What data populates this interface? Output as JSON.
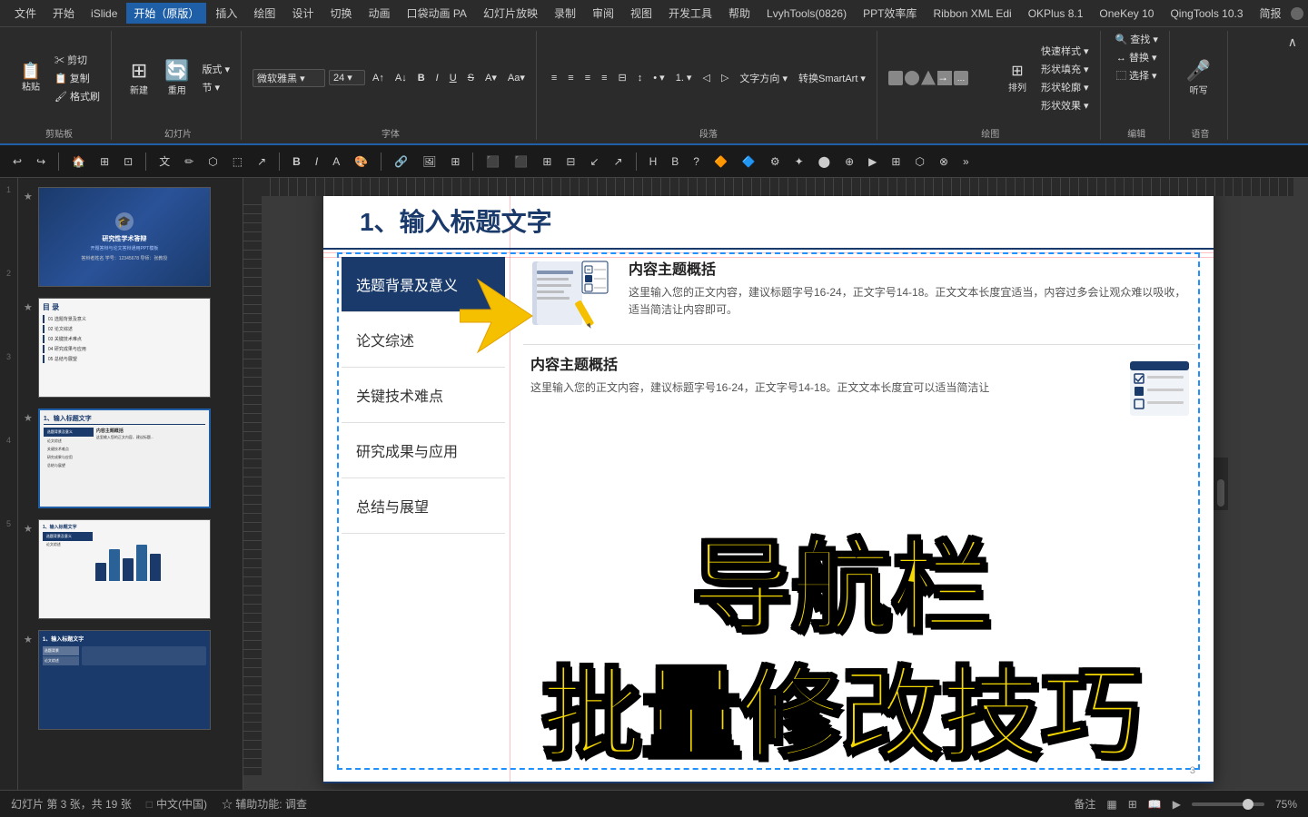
{
  "menubar": {
    "items": [
      "文件",
      "开始",
      "iSlide",
      "开始（原版）",
      "插入",
      "绘图",
      "设计",
      "切换",
      "动画",
      "口袋动画 PA",
      "幻灯片放映",
      "录制",
      "审阅",
      "视图",
      "开发工具",
      "帮助",
      "LvyhTools(0826)",
      "PPT效率库",
      "Ribbon XML Edi",
      "OKPlus 8.1",
      "OneKey 10",
      "QingTools 10.3",
      "简报"
    ],
    "active": "开始（原版）"
  },
  "ribbon": {
    "groups": [
      {
        "name": "剪贴板",
        "buttons": [
          "粘贴",
          "剪切",
          "复制",
          "格式刷"
        ]
      },
      {
        "name": "幻灯片",
        "buttons": [
          "新建幻灯片",
          "重用幻灯片",
          "版式",
          "节"
        ]
      },
      {
        "name": "字体",
        "buttons": [
          "B",
          "I",
          "U",
          "S",
          "字体",
          "字号",
          "颜色"
        ]
      },
      {
        "name": "段落",
        "buttons": [
          "左对齐",
          "居中",
          "右对齐",
          "两端对齐",
          "分散对齐",
          "项目符号",
          "编号"
        ]
      },
      {
        "name": "绘图",
        "buttons": [
          "形状",
          "排列",
          "快速样式",
          "形状填充",
          "形状轮廓",
          "形状效果"
        ]
      },
      {
        "name": "编辑",
        "buttons": [
          "查找",
          "替换",
          "选择"
        ]
      },
      {
        "name": "语音",
        "buttons": [
          "听写"
        ]
      }
    ]
  },
  "formatbar": {
    "buttons": [
      "✂",
      "📋",
      "B",
      "I",
      "U",
      "A",
      "⬜",
      "⭕",
      "△",
      "→",
      "T",
      "🔗"
    ]
  },
  "slides": [
    {
      "number": "1",
      "title": "研究性学术答辩",
      "subtitle": "开题答辩与论文答辩通用PPT模板",
      "author": "答辩者姓名 学号：12345678 导师：张教授"
    },
    {
      "number": "2",
      "title": "目录"
    },
    {
      "number": "3",
      "title": "1、输入标题文字",
      "active": true
    },
    {
      "number": "4",
      "title": "1、输入标题文字"
    },
    {
      "number": "5",
      "title": "1、输入标题文字"
    }
  ],
  "slide_active": {
    "title": "1、输入标题文字",
    "nav_items": [
      "选题背景及意义",
      "论文综述",
      "关键技术难点",
      "研究成果与应用",
      "总结与展望"
    ],
    "nav_active": "选题背景及意义",
    "content_heading_1": "内容主题概括",
    "content_body_1": "这里输入您的正文内容，建议标题字号16-24，正文字号14-18。正文文本长度宜适当，内容过多会让观众难以吸收，适当简洁让内容即可。",
    "content_heading_2": "内容主题概括",
    "content_body_2": "这里输入您的正文内容，建议标题字号16-24，正文字号14-18。正文文本长度宜可以适当简洁让",
    "overlay_line1": "导航栏",
    "overlay_line2": "批量修改技巧"
  },
  "statusbar": {
    "slide_info": "幻灯片 第 3 张，共 19 张",
    "language": "中文(中国)",
    "accessibility": "☆ 辅助功能: 调查",
    "notes": "备注",
    "view_normal": "▦",
    "view_slide_sorter": "⊞",
    "view_reading": "📖",
    "view_slideshow": "▶",
    "zoom": "75%"
  },
  "icons": {
    "paste": "📋",
    "cut": "✂",
    "copy": "📋",
    "format_painter": "🖌",
    "new_slide": "➕",
    "bold": "B",
    "italic": "I",
    "underline": "U",
    "search": "🔍",
    "microphone": "🎤",
    "arrow_down": "▾"
  }
}
